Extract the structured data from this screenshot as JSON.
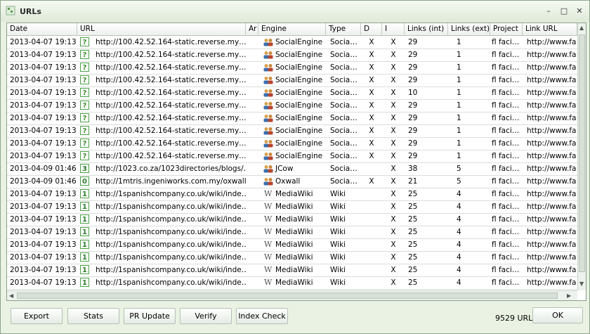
{
  "window": {
    "title": "URLs"
  },
  "columns": [
    "Date",
    "URL",
    "Ar",
    "Engine",
    "Type",
    "D",
    "I",
    "Links (int)",
    "Links (ext)",
    "Project",
    "Link URL"
  ],
  "rows": [
    {
      "date": "2013-04-07 19:13",
      "pr": "?",
      "url": "http://100.42.52.164-static.reverse.my…",
      "engine": "SocialEngine",
      "engine_icon": "users-icon",
      "type": "Socia…",
      "d": "X",
      "i": "X",
      "links_int": "29",
      "links_ext": "1",
      "project": "fl faci…",
      "link_url": "http://www.fa"
    },
    {
      "date": "2013-04-07 19:13",
      "pr": "?",
      "url": "http://100.42.52.164-static.reverse.my…",
      "engine": "SocialEngine",
      "engine_icon": "users-icon",
      "type": "Socia…",
      "d": "X",
      "i": "X",
      "links_int": "29",
      "links_ext": "1",
      "project": "fl faci…",
      "link_url": "http://www.fa"
    },
    {
      "date": "2013-04-07 19:13",
      "pr": "?",
      "url": "http://100.42.52.164-static.reverse.my…",
      "engine": "SocialEngine",
      "engine_icon": "users-icon",
      "type": "Socia…",
      "d": "X",
      "i": "X",
      "links_int": "29",
      "links_ext": "1",
      "project": "fl faci…",
      "link_url": "http://www.fa"
    },
    {
      "date": "2013-04-07 19:13",
      "pr": "?",
      "url": "http://100.42.52.164-static.reverse.my…",
      "engine": "SocialEngine",
      "engine_icon": "users-icon",
      "type": "Socia…",
      "d": "X",
      "i": "X",
      "links_int": "29",
      "links_ext": "1",
      "project": "fl faci…",
      "link_url": "http://www.fa"
    },
    {
      "date": "2013-04-07 19:13",
      "pr": "?",
      "url": "http://100.42.52.164-static.reverse.my…",
      "engine": "SocialEngine",
      "engine_icon": "users-icon",
      "type": "Socia…",
      "d": "X",
      "i": "X",
      "links_int": "10",
      "links_ext": "1",
      "project": "fl faci…",
      "link_url": "http://www.fa"
    },
    {
      "date": "2013-04-07 19:13",
      "pr": "?",
      "url": "http://100.42.52.164-static.reverse.my…",
      "engine": "SocialEngine",
      "engine_icon": "users-icon",
      "type": "Socia…",
      "d": "X",
      "i": "X",
      "links_int": "29",
      "links_ext": "1",
      "project": "fl faci…",
      "link_url": "http://www.fa"
    },
    {
      "date": "2013-04-07 19:13",
      "pr": "?",
      "url": "http://100.42.52.164-static.reverse.my…",
      "engine": "SocialEngine",
      "engine_icon": "users-icon",
      "type": "Socia…",
      "d": "X",
      "i": "X",
      "links_int": "29",
      "links_ext": "1",
      "project": "fl faci…",
      "link_url": "http://www.fa"
    },
    {
      "date": "2013-04-07 19:13",
      "pr": "?",
      "url": "http://100.42.52.164-static.reverse.my…",
      "engine": "SocialEngine",
      "engine_icon": "users-icon",
      "type": "Socia…",
      "d": "X",
      "i": "X",
      "links_int": "29",
      "links_ext": "1",
      "project": "fl faci…",
      "link_url": "http://www.fa"
    },
    {
      "date": "2013-04-07 19:13",
      "pr": "?",
      "url": "http://100.42.52.164-static.reverse.my…",
      "engine": "SocialEngine",
      "engine_icon": "users-icon",
      "type": "Socia…",
      "d": "X",
      "i": "X",
      "links_int": "29",
      "links_ext": "1",
      "project": "fl faci…",
      "link_url": "http://www.fa"
    },
    {
      "date": "2013-04-07 19:13",
      "pr": "?",
      "url": "http://100.42.52.164-static.reverse.my…",
      "engine": "SocialEngine",
      "engine_icon": "users-icon",
      "type": "Socia…",
      "d": "X",
      "i": "X",
      "links_int": "29",
      "links_ext": "1",
      "project": "fl faci…",
      "link_url": "http://www.fa"
    },
    {
      "date": "2013-04-09 01:46",
      "pr": "3",
      "url": "http://1023.co.za/1023directories/blogs/…",
      "engine": "JCow",
      "engine_icon": "users-icon",
      "type": "Socia…",
      "d": "",
      "i": "X",
      "links_int": "38",
      "links_ext": "5",
      "project": "fl faci…",
      "link_url": "http://www.fa"
    },
    {
      "date": "2013-04-09 01:46",
      "pr": "0",
      "url": "http://1mtris.ingeniworks.com.my/oxwall…",
      "engine": "Oxwall",
      "engine_icon": "users-icon",
      "type": "Socia…",
      "d": "X",
      "i": "X",
      "links_int": "21",
      "links_ext": "5",
      "project": "fl faci…",
      "link_url": "http://www.fa"
    },
    {
      "date": "2013-04-07 19:13",
      "pr": "1",
      "url": "http://1spanishcompany.co.uk/wiki/inde…",
      "engine": "MediaWiki",
      "engine_icon": "wiki-icon",
      "type": "Wiki",
      "d": "",
      "i": "X",
      "links_int": "25",
      "links_ext": "4",
      "project": "fl faci…",
      "link_url": "http://www.fa"
    },
    {
      "date": "2013-04-07 19:13",
      "pr": "1",
      "url": "http://1spanishcompany.co.uk/wiki/inde…",
      "engine": "MediaWiki",
      "engine_icon": "wiki-icon",
      "type": "Wiki",
      "d": "",
      "i": "X",
      "links_int": "25",
      "links_ext": "4",
      "project": "fl faci…",
      "link_url": "http://www.fa"
    },
    {
      "date": "2013-04-07 19:13",
      "pr": "1",
      "url": "http://1spanishcompany.co.uk/wiki/inde…",
      "engine": "MediaWiki",
      "engine_icon": "wiki-icon",
      "type": "Wiki",
      "d": "",
      "i": "X",
      "links_int": "25",
      "links_ext": "4",
      "project": "fl faci…",
      "link_url": "http://www.fa"
    },
    {
      "date": "2013-04-07 19:13",
      "pr": "1",
      "url": "http://1spanishcompany.co.uk/wiki/inde…",
      "engine": "MediaWiki",
      "engine_icon": "wiki-icon",
      "type": "Wiki",
      "d": "",
      "i": "X",
      "links_int": "25",
      "links_ext": "4",
      "project": "fl faci…",
      "link_url": "http://www.fa"
    },
    {
      "date": "2013-04-07 19:13",
      "pr": "1",
      "url": "http://1spanishcompany.co.uk/wiki/inde…",
      "engine": "MediaWiki",
      "engine_icon": "wiki-icon",
      "type": "Wiki",
      "d": "",
      "i": "X",
      "links_int": "25",
      "links_ext": "4",
      "project": "fl faci…",
      "link_url": "http://www.fa"
    },
    {
      "date": "2013-04-07 19:13",
      "pr": "1",
      "url": "http://1spanishcompany.co.uk/wiki/inde…",
      "engine": "MediaWiki",
      "engine_icon": "wiki-icon",
      "type": "Wiki",
      "d": "",
      "i": "X",
      "links_int": "25",
      "links_ext": "4",
      "project": "fl faci…",
      "link_url": "http://www.fa"
    },
    {
      "date": "2013-04-07 19:13",
      "pr": "1",
      "url": "http://1spanishcompany.co.uk/wiki/inde…",
      "engine": "MediaWiki",
      "engine_icon": "wiki-icon",
      "type": "Wiki",
      "d": "",
      "i": "X",
      "links_int": "25",
      "links_ext": "4",
      "project": "fl faci…",
      "link_url": "http://www.fa"
    },
    {
      "date": "2013-04-07 19:13",
      "pr": "1",
      "url": "http://1spanishcompany.co.uk/wiki/inde…",
      "engine": "MediaWiki",
      "engine_icon": "wiki-icon",
      "type": "Wiki",
      "d": "",
      "i": "X",
      "links_int": "25",
      "links_ext": "4",
      "project": "fl faci…",
      "link_url": "http://www.fa"
    }
  ],
  "buttons": {
    "export": "Export",
    "stats": "Stats",
    "pr_update": "PR Update",
    "verify": "Verify",
    "index_check": "Index Check",
    "ok": "OK"
  },
  "status": {
    "count": "9529 URLs"
  }
}
